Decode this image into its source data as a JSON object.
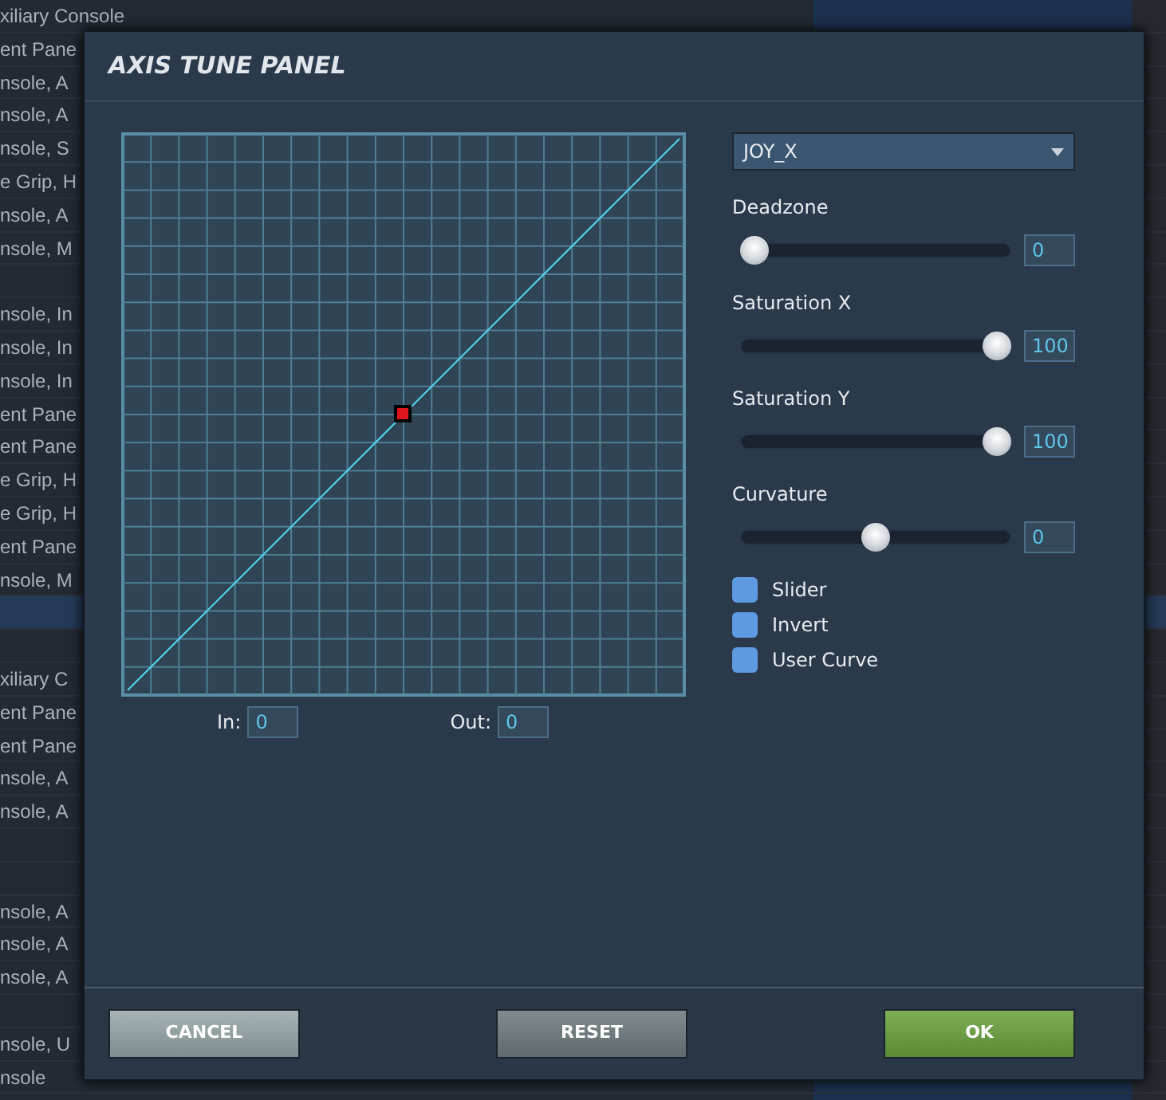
{
  "background_list": {
    "rows": [
      {
        "text": "xiliary Console",
        "selected": false
      },
      {
        "text": "ent Pane",
        "selected": false
      },
      {
        "text": "nsole, A",
        "selected": false
      },
      {
        "text": "nsole, A",
        "selected": false
      },
      {
        "text": "nsole, S",
        "selected": false
      },
      {
        "text": "e Grip, H",
        "selected": false
      },
      {
        "text": "nsole, A",
        "selected": false
      },
      {
        "text": "nsole, M",
        "selected": false
      },
      {
        "selected": false
      },
      {
        "text": "nsole, In",
        "selected": false
      },
      {
        "text": "nsole, In",
        "selected": false
      },
      {
        "text": "nsole, In",
        "selected": false
      },
      {
        "text": "ent Pane",
        "selected": false
      },
      {
        "text": "ent Pane",
        "selected": false
      },
      {
        "text": "e Grip, H",
        "selected": false
      },
      {
        "text": "e Grip, H",
        "selected": false
      },
      {
        "text": "ent Pane",
        "selected": false
      },
      {
        "text": "nsole, M",
        "selected": false
      },
      {
        "selected": true
      },
      {
        "selected": false
      },
      {
        "text": "xiliary C",
        "selected": false
      },
      {
        "text": "ent Pane",
        "selected": false
      },
      {
        "text": "ent Pane",
        "selected": false
      },
      {
        "text": "nsole, A",
        "selected": false
      },
      {
        "text": "nsole, A",
        "selected": false
      },
      {
        "selected": false
      },
      {
        "selected": false
      },
      {
        "text": "nsole, A",
        "selected": false
      },
      {
        "text": "nsole, A",
        "selected": false
      },
      {
        "text": "nsole, A",
        "selected": false
      },
      {
        "selected": false
      },
      {
        "text": "nsole, U",
        "selected": false
      },
      {
        "text": "nsole",
        "selected": false
      }
    ]
  },
  "dialog": {
    "title": "AXIS TUNE PANEL",
    "axis_select": {
      "value": "JOY_X"
    },
    "in": {
      "label": "In:",
      "value": "0"
    },
    "out": {
      "label": "Out:",
      "value": "0"
    },
    "sliders": [
      {
        "label": "Deadzone",
        "level": 0,
        "value": "0"
      },
      {
        "label": "Saturation X",
        "level": 1,
        "value": "100"
      },
      {
        "label": "Saturation Y",
        "level": 1,
        "value": "100"
      },
      {
        "label": "Curvature",
        "level": 0.5,
        "value": "0"
      }
    ],
    "checkboxes": [
      {
        "label": "Slider",
        "checked": false
      },
      {
        "label": "Invert",
        "checked": false
      },
      {
        "label": "User Curve",
        "checked": false
      }
    ],
    "buttons": [
      {
        "label": "CANCEL",
        "kind": "cancel"
      },
      {
        "label": "RESET",
        "kind": "reset"
      },
      {
        "label": "OK",
        "kind": "ok"
      }
    ]
  }
}
